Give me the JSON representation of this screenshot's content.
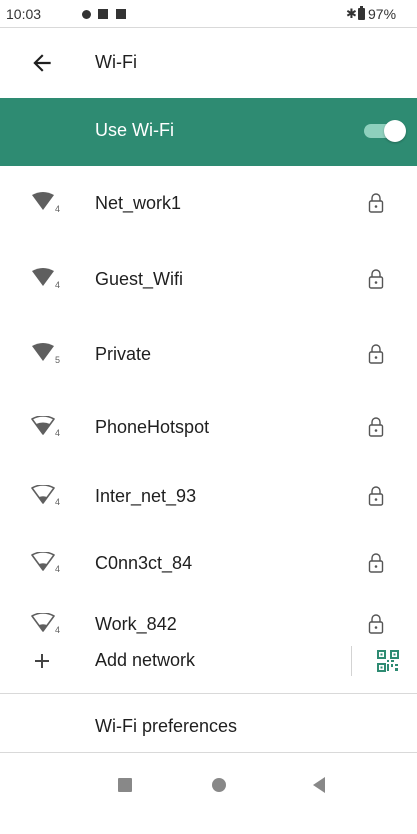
{
  "status_bar": {
    "time": "10:03",
    "battery_pct": "97%",
    "bluetooth_glyph": "✱",
    "icons": [
      "notification-dot-icon",
      "notification-square-icon",
      "notification-square-icon",
      "bluetooth-icon",
      "battery-icon"
    ]
  },
  "app_bar": {
    "back_icon": "arrow-left-icon",
    "title": "Wi-Fi"
  },
  "master_switch": {
    "label": "Use Wi-Fi",
    "enabled": true
  },
  "networks": [
    {
      "name": "Net_work1",
      "strength": "full",
      "generation": "4",
      "secured": true
    },
    {
      "name": "Guest_Wifi",
      "strength": "full",
      "generation": "4",
      "secured": true
    },
    {
      "name": "Private",
      "strength": "full",
      "generation": "5",
      "secured": true
    },
    {
      "name": "PhoneHotspot",
      "strength": "medium",
      "generation": "4",
      "secured": true
    },
    {
      "name": "Inter_net_93",
      "strength": "low",
      "generation": "4",
      "secured": true
    },
    {
      "name": "C0nn3ct_84",
      "strength": "low",
      "generation": "4",
      "secured": true
    },
    {
      "name": "Work_842",
      "strength": "low",
      "generation": "4",
      "secured": true
    }
  ],
  "add_network": {
    "label": "Add network",
    "plus_icon": "plus-icon",
    "qr_icon": "qr-code-scan-icon"
  },
  "preferences": {
    "label": "Wi-Fi preferences"
  },
  "nav_bar": {
    "buttons": [
      "recents-icon",
      "home-icon",
      "back-triangle-icon"
    ]
  },
  "colors": {
    "accent": "#2e8b72",
    "switch_track": "#8ed0bd",
    "icon": "#5f5f5f"
  }
}
